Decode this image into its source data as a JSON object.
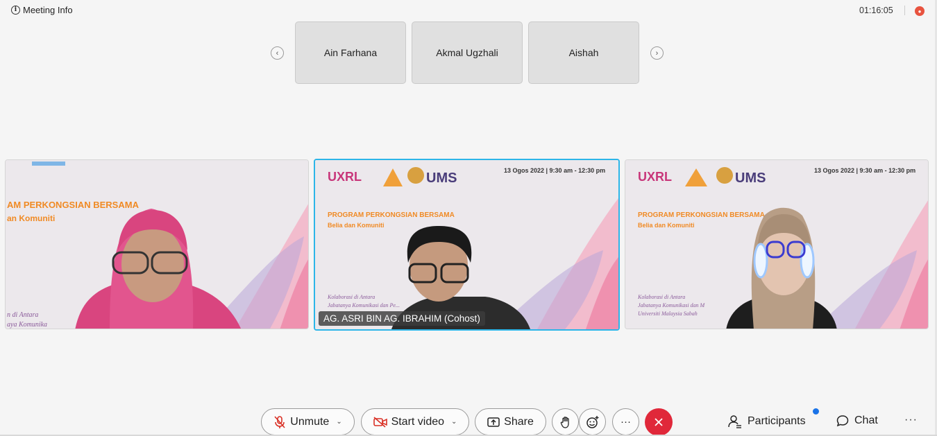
{
  "topbar": {
    "meeting_info": "Meeting Info",
    "timer": "01:16:05",
    "rec_icon": "record-indicator-icon"
  },
  "strip": {
    "participants": [
      "Ain Farhana",
      "Akmal Ugzhali",
      "Aishah"
    ],
    "prev_icon": "chevron-left-icon",
    "next_icon": "chevron-right-icon"
  },
  "videos": {
    "left": {
      "banner_title": "AM PERKONGSIAN BERSAMA",
      "banner_sub": "an Komuniti",
      "banner_foot1": "n di Antara",
      "banner_foot2": "aya Komunika"
    },
    "center": {
      "name_label": "AG. ASRI BIN AG. IBRAHIM (Cohost)",
      "logo_text": "UMS",
      "date": "13 Ogos 2022 | 9:30 am - 12:30 pm",
      "banner_title": "PROGRAM PERKONGSIAN BERSAMA",
      "banner_sub": "Belia dan Komuniti",
      "banner_foot1": "Kolaborasi di Antara",
      "banner_foot2": "Jabatanya Komunikasi dan Pe..."
    },
    "right": {
      "logo_text": "UMS",
      "date": "13 Ogos 2022 | 9:30 am - 12:30 pm",
      "banner_title": "PROGRAM PERKONGSIAN BERSAMA",
      "banner_sub": "Belia dan Komuniti",
      "banner_foot1": "Kolaborasi di Antara",
      "banner_foot2": "Jabatanya Komunikasi dan M",
      "banner_foot3": "Universiti Malaysia Sabah"
    }
  },
  "toolbar": {
    "unmute": "Unmute",
    "start_video": "Start video",
    "share": "Share",
    "participants": "Participants",
    "chat": "Chat",
    "more": "···"
  },
  "colors": {
    "accent_border": "#2cb5e8",
    "end_call": "#e0283a",
    "notification": "#1a73e8",
    "banner_orange": "#f08a24"
  }
}
